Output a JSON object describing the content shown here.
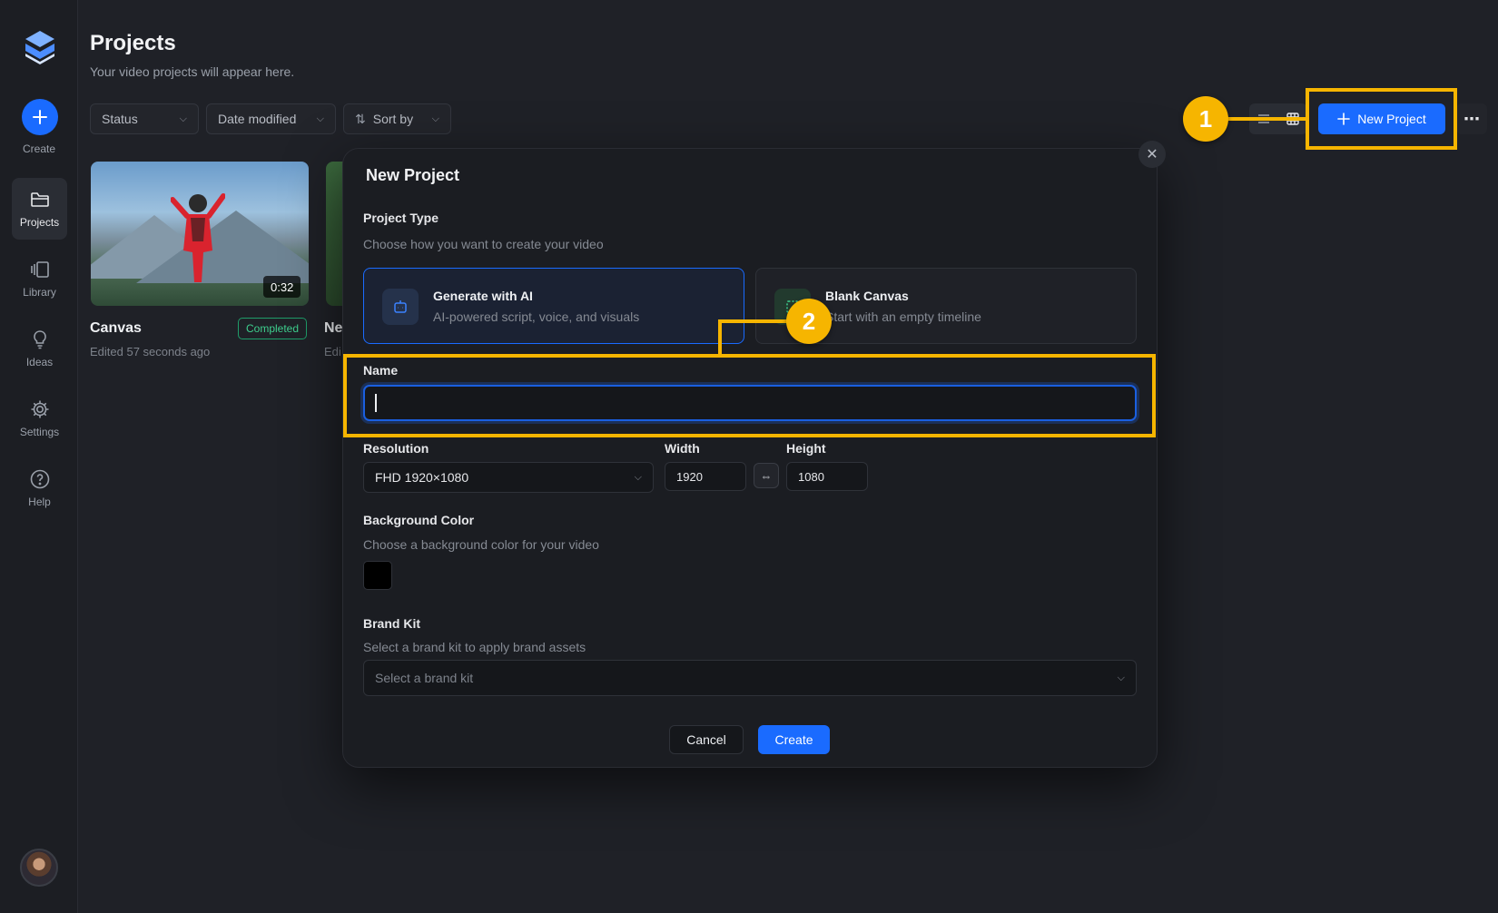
{
  "sidebar": {
    "create_label": "Create",
    "items": [
      {
        "label": "Projects",
        "icon": "folder-icon",
        "active": true
      },
      {
        "label": "Library",
        "icon": "library-icon",
        "active": false
      },
      {
        "label": "Ideas",
        "icon": "lightbulb-icon",
        "active": false
      },
      {
        "label": "Settings",
        "icon": "gear-icon",
        "active": false
      },
      {
        "label": "Help",
        "icon": "help-icon",
        "active": false
      }
    ]
  },
  "header": {
    "title": "Projects",
    "subtitle": "Your video projects will appear here."
  },
  "filters": {
    "status": "Status",
    "date_modified": "Date modified",
    "sort_by": "Sort by"
  },
  "toolbar": {
    "new_project_label": "New Project"
  },
  "projects": [
    {
      "title": "Canvas",
      "edited": "Edited 57 seconds ago",
      "duration": "0:32",
      "status": "Completed"
    },
    {
      "title": "Ne",
      "edited": "Edi"
    }
  ],
  "modal": {
    "title": "New Project",
    "project_type": {
      "label": "Project Type",
      "help": "Choose how you want to create your video",
      "options": [
        {
          "title": "Generate with AI",
          "desc": "AI-powered script, voice, and visuals",
          "selected": true
        },
        {
          "title": "Blank Canvas",
          "desc": "Start with an empty timeline",
          "selected": false
        }
      ]
    },
    "name": {
      "label": "Name",
      "value": ""
    },
    "resolution": {
      "label": "Resolution",
      "value": "FHD 1920×1080"
    },
    "width": {
      "label": "Width",
      "value": "1920"
    },
    "height": {
      "label": "Height",
      "value": "1080"
    },
    "background": {
      "label": "Background Color",
      "help": "Choose a background color for your video",
      "color": "#000000"
    },
    "brand_kit": {
      "label": "Brand Kit",
      "help": "Select a brand kit to apply brand assets",
      "placeholder": "Select a brand kit"
    },
    "cancel_label": "Cancel",
    "create_label": "Create"
  },
  "annotations": [
    {
      "number": "1"
    },
    {
      "number": "2"
    }
  ],
  "colors": {
    "accent": "#1a6bff",
    "highlight": "#f6b500",
    "success": "#3ecf8e"
  }
}
